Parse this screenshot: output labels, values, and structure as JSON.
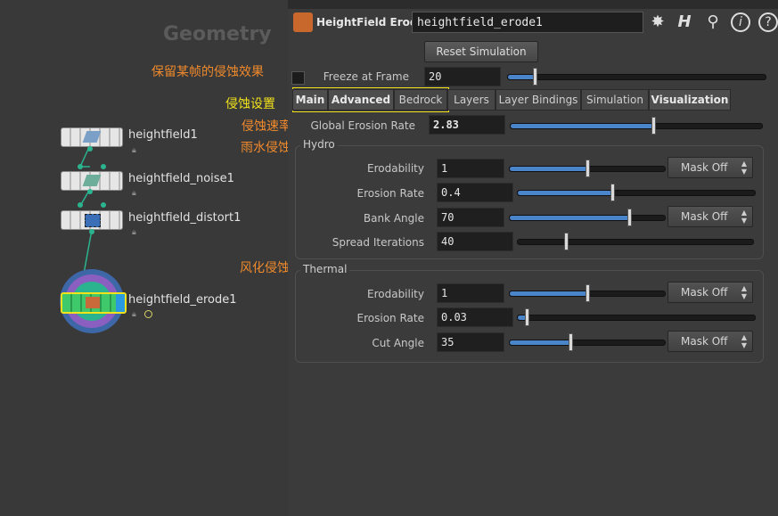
{
  "network": {
    "title": "Geometry",
    "nodes": [
      {
        "label": "heightfield1"
      },
      {
        "label": "heightfield_noise1"
      },
      {
        "label": "heightfield_distort1"
      },
      {
        "label": "heightfield_erode1"
      }
    ]
  },
  "annotations": {
    "freeze": "保留某帧的侵蚀效果",
    "tabs": "侵蚀设置",
    "rate": "侵蚀速率",
    "hydro": "雨水侵蚀",
    "thermal": "风化侵蚀"
  },
  "colors": {
    "annotation_orange": "#f08a2c",
    "annotation_yellow": "#f2e21a",
    "slider_fill": "#4a84c9"
  },
  "header": {
    "node_type": "HeightField Erode",
    "node_name": "heightfield_erode1",
    "icons": [
      "gear-icon",
      "houdini-h-icon",
      "search-icon",
      "info-icon",
      "help-icon"
    ]
  },
  "reset_button": "Reset Simulation",
  "freeze": {
    "label": "Freeze at Frame",
    "value": "20",
    "level": 0.1
  },
  "tabs": [
    "Main",
    "Advanced",
    "Bedrock",
    "Layers",
    "Layer Bindings",
    "Simulation",
    "Visualization"
  ],
  "global_rate": {
    "label": "Global Erosion Rate",
    "value": "2.83",
    "level": 0.57
  },
  "hydro": {
    "title": "Hydro",
    "erodability": {
      "label": "Erodability",
      "value": "1",
      "level": 0.5,
      "mask": "Mask Off"
    },
    "erosion_rate": {
      "label": "Erosion Rate",
      "value": "0.4",
      "level": 0.4
    },
    "bank_angle": {
      "label": "Bank Angle",
      "value": "70",
      "level": 0.78,
      "mask": "Mask Off"
    },
    "spread": {
      "label": "Spread Iterations",
      "value": "40",
      "level": 0.2
    }
  },
  "thermal": {
    "title": "Thermal",
    "erodability": {
      "label": "Erodability",
      "value": "1",
      "level": 0.5,
      "mask": "Mask Off"
    },
    "erosion_rate": {
      "label": "Erosion Rate",
      "value": "0.03",
      "level": 0.03
    },
    "cut_angle": {
      "label": "Cut Angle",
      "value": "35",
      "level": 0.39,
      "mask": "Mask Off"
    }
  }
}
